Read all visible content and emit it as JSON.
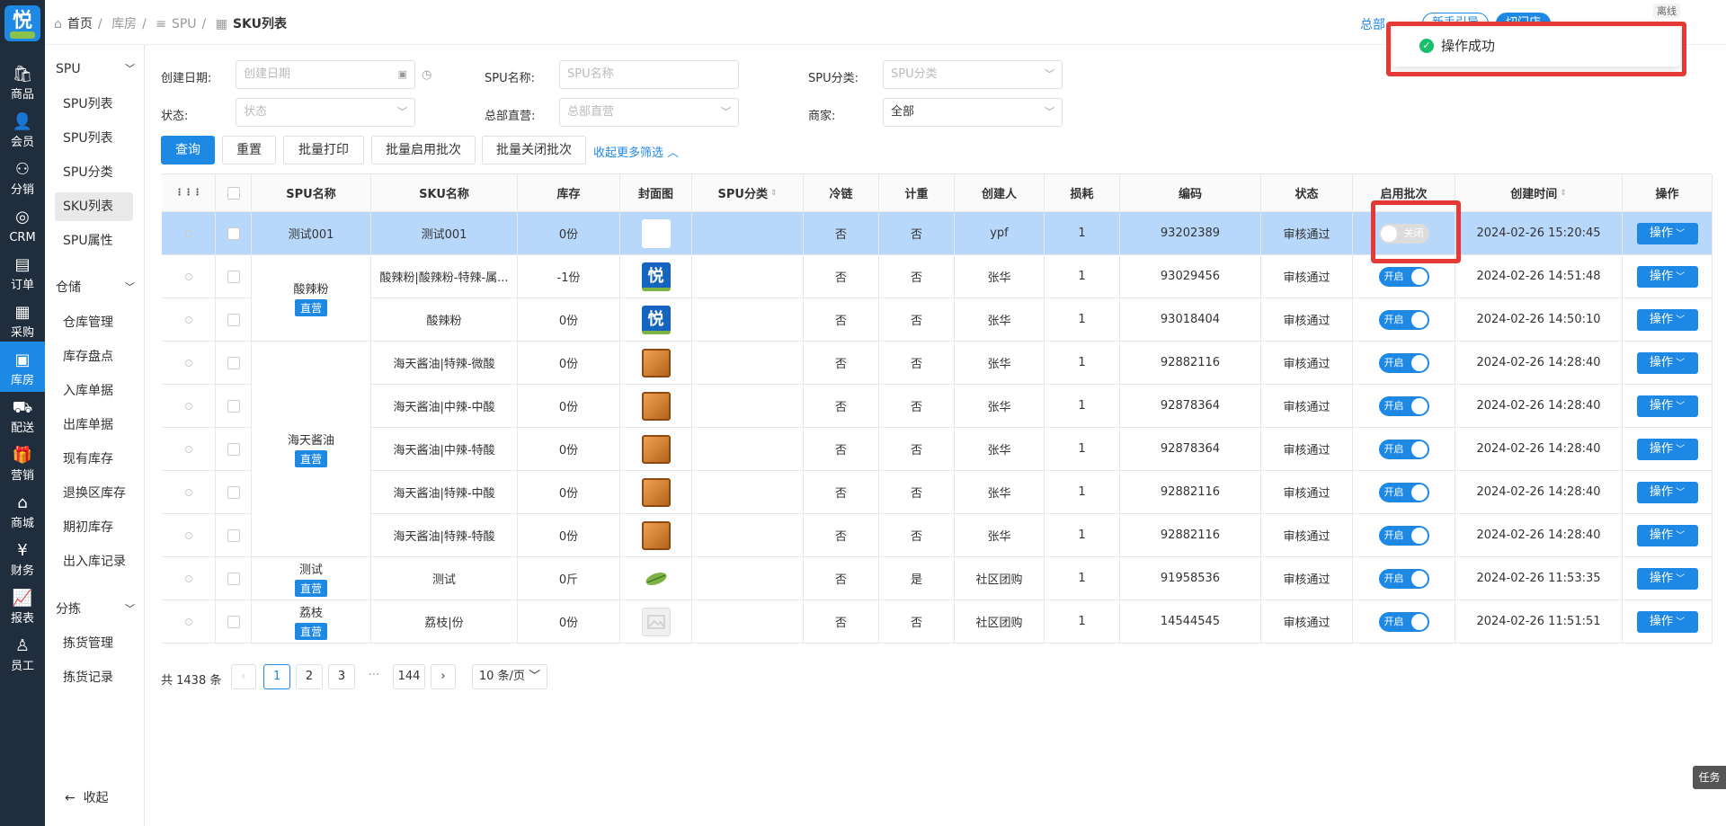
{
  "rail": {
    "logo": "悦",
    "items": [
      "商品",
      "会员",
      "分销",
      "CRM",
      "订单",
      "采购",
      "库房",
      "配送",
      "营销",
      "商城",
      "财务",
      "报表",
      "员工"
    ]
  },
  "submenu": {
    "spu_group": "SPU",
    "spu_items": [
      "SPU列表",
      "SPU列表",
      "SPU分类",
      "SKU列表",
      "SPU属性"
    ],
    "store_group": "仓储",
    "store_items": [
      "仓库管理",
      "库存盘点",
      "入库单据",
      "出库单据",
      "现有库存",
      "退换区库存",
      "期初库存",
      "出入库记录"
    ],
    "pick_group": "分拣",
    "pick_items": [
      "拣货管理",
      "拣货记录"
    ],
    "collapse": "收起"
  },
  "breadcrumb": {
    "home": "首页",
    "b1": "库房",
    "b2": "SPU",
    "current": "SKU列表"
  },
  "topbar": {
    "hq": "总部",
    "btn1": "新手引导",
    "btn2": "切门店",
    "offline": "离线"
  },
  "toast": {
    "text": "操作成功"
  },
  "filters": {
    "create_date_label": "创建日期:",
    "create_date_ph": "创建日期",
    "spu_name_label": "SPU名称:",
    "spu_name_ph": "SPU名称",
    "spu_cat_label": "SPU分类:",
    "spu_cat_ph": "SPU分类",
    "status_label": "状态:",
    "status_ph": "状态",
    "hq_label": "总部直营:",
    "hq_ph": "总部直营",
    "merchant_label": "商家:",
    "merchant_val": "全部"
  },
  "actions": {
    "query": "查询",
    "reset": "重置",
    "batch_print": "批量打印",
    "batch_enable": "批量启用批次",
    "batch_close": "批量关闭批次",
    "collapse_more": "收起更多筛选"
  },
  "table": {
    "headers": [
      "SPU名称",
      "SKU名称",
      "库存",
      "封面图",
      "SPU分类",
      "冷链",
      "计重",
      "创建人",
      "损耗",
      "编码",
      "状态",
      "启用批次",
      "创建时间",
      "操作"
    ],
    "spu_groups": [
      {
        "name": "测试001",
        "tag": ""
      },
      {
        "name": "酸辣粉",
        "tag": "直营"
      },
      {
        "name": "海天酱油",
        "tag": "直营"
      },
      {
        "name": "测试",
        "tag": "直营"
      },
      {
        "name": "荔枝",
        "tag": "直营"
      }
    ],
    "rows": [
      {
        "sku": "测试001",
        "stock": "0份",
        "cover": "white",
        "cold": "否",
        "weigh": "否",
        "creator": "ypf",
        "loss": "1",
        "code": "93202389",
        "status": "审核通过",
        "batch": "关闭",
        "on": false,
        "time": "2024-02-26 15:20:45",
        "op": "操作"
      },
      {
        "sku": "酸辣粉|酸辣粉-特辣-属...",
        "stock": "-1份",
        "cover": "logo",
        "cold": "否",
        "weigh": "否",
        "creator": "张华",
        "loss": "1",
        "code": "93029456",
        "status": "审核通过",
        "batch": "开启",
        "on": true,
        "time": "2024-02-26 14:51:48",
        "op": "操作"
      },
      {
        "sku": "酸辣粉",
        "stock": "0份",
        "cover": "logo",
        "cold": "否",
        "weigh": "否",
        "creator": "张华",
        "loss": "1",
        "code": "93018404",
        "status": "审核通过",
        "batch": "开启",
        "on": true,
        "time": "2024-02-26 14:50:10",
        "op": "操作"
      },
      {
        "sku": "海天酱油|特辣-微酸",
        "stock": "0份",
        "cover": "box",
        "cold": "否",
        "weigh": "否",
        "creator": "张华",
        "loss": "1",
        "code": "92882116",
        "status": "审核通过",
        "batch": "开启",
        "on": true,
        "time": "2024-02-26 14:28:40",
        "op": "操作"
      },
      {
        "sku": "海天酱油|中辣-中酸",
        "stock": "0份",
        "cover": "box",
        "cold": "否",
        "weigh": "否",
        "creator": "张华",
        "loss": "1",
        "code": "92878364",
        "status": "审核通过",
        "batch": "开启",
        "on": true,
        "time": "2024-02-26 14:28:40",
        "op": "操作"
      },
      {
        "sku": "海天酱油|中辣-特酸",
        "stock": "0份",
        "cover": "box",
        "cold": "否",
        "weigh": "否",
        "creator": "张华",
        "loss": "1",
        "code": "92878364",
        "status": "审核通过",
        "batch": "开启",
        "on": true,
        "time": "2024-02-26 14:28:40",
        "op": "操作"
      },
      {
        "sku": "海天酱油|特辣-中酸",
        "stock": "0份",
        "cover": "box",
        "cold": "否",
        "weigh": "否",
        "creator": "张华",
        "loss": "1",
        "code": "92882116",
        "status": "审核通过",
        "batch": "开启",
        "on": true,
        "time": "2024-02-26 14:28:40",
        "op": "操作"
      },
      {
        "sku": "海天酱油|特辣-特酸",
        "stock": "0份",
        "cover": "box",
        "cold": "否",
        "weigh": "否",
        "creator": "张华",
        "loss": "1",
        "code": "92882116",
        "status": "审核通过",
        "batch": "开启",
        "on": true,
        "time": "2024-02-26 14:28:40",
        "op": "操作"
      },
      {
        "sku": "测试",
        "stock": "0斤",
        "cover": "leaf",
        "cold": "否",
        "weigh": "是",
        "creator": "社区团购",
        "loss": "1",
        "code": "91958536",
        "status": "审核通过",
        "batch": "开启",
        "on": true,
        "time": "2024-02-26 11:53:35",
        "op": "操作"
      },
      {
        "sku": "荔枝|份",
        "stock": "0份",
        "cover": "img",
        "cold": "否",
        "weigh": "否",
        "creator": "社区团购",
        "loss": "1",
        "code": "14544545",
        "status": "审核通过",
        "batch": "开启",
        "on": true,
        "time": "2024-02-26 11:51:51",
        "op": "操作"
      }
    ]
  },
  "pagination": {
    "total": "共 1438 条",
    "pages": [
      "1",
      "2",
      "3",
      "144"
    ],
    "ellipsis": "···",
    "size": "10 条/页"
  },
  "task": "任务"
}
